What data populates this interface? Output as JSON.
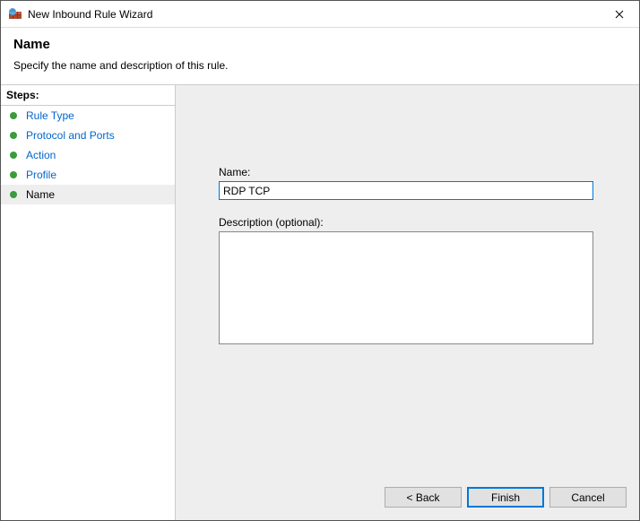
{
  "window": {
    "title": "New Inbound Rule Wizard"
  },
  "header": {
    "title": "Name",
    "subtitle": "Specify the name and description of this rule."
  },
  "sidebar": {
    "heading": "Steps:",
    "items": [
      {
        "label": "Rule Type",
        "state": "done"
      },
      {
        "label": "Protocol and Ports",
        "state": "done"
      },
      {
        "label": "Action",
        "state": "done"
      },
      {
        "label": "Profile",
        "state": "done"
      },
      {
        "label": "Name",
        "state": "current"
      }
    ]
  },
  "form": {
    "name_label": "Name:",
    "name_value": "RDP TCP",
    "description_label": "Description (optional):",
    "description_value": ""
  },
  "buttons": {
    "back": "< Back",
    "finish": "Finish",
    "cancel": "Cancel"
  }
}
